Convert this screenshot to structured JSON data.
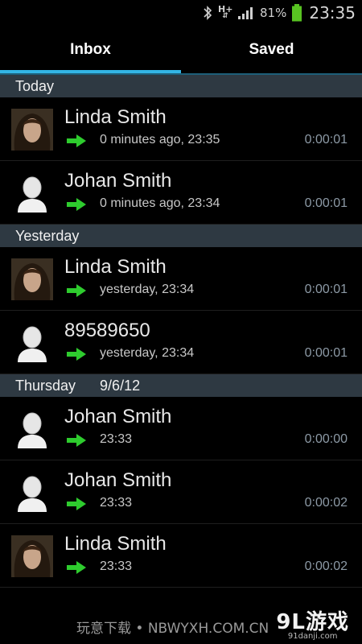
{
  "status_bar": {
    "network": "H+",
    "battery_percent": "81%",
    "time": "23:35",
    "icons": [
      "bluetooth-icon",
      "network-arrows-icon",
      "signal-icon",
      "battery-icon"
    ]
  },
  "tabs": [
    {
      "label": "Inbox",
      "active": true
    },
    {
      "label": "Saved",
      "active": false
    }
  ],
  "sections": [
    {
      "title": "Today",
      "date": "",
      "calls": [
        {
          "name": "Linda Smith",
          "when": "0 minutes ago, 23:35",
          "duration": "0:00:01",
          "avatar": "photo"
        },
        {
          "name": "Johan Smith",
          "when": "0 minutes ago, 23:34",
          "duration": "0:00:01",
          "avatar": "default"
        }
      ]
    },
    {
      "title": "Yesterday",
      "date": "",
      "calls": [
        {
          "name": "Linda Smith",
          "when": "yesterday, 23:34",
          "duration": "0:00:01",
          "avatar": "photo"
        },
        {
          "name": "89589650",
          "when": "yesterday, 23:34",
          "duration": "0:00:01",
          "avatar": "default"
        }
      ]
    },
    {
      "title": "Thursday",
      "date": "9/6/12",
      "calls": [
        {
          "name": "Johan Smith",
          "when": "23:33",
          "duration": "0:00:00",
          "avatar": "default"
        },
        {
          "name": "Johan Smith",
          "when": "23:33",
          "duration": "0:00:02",
          "avatar": "default"
        },
        {
          "name": "Linda Smith",
          "when": "23:33",
          "duration": "0:00:02",
          "avatar": "photo"
        }
      ]
    }
  ],
  "watermark": {
    "text": "玩意下载 • NBWYXH.COM.CN",
    "logo": "9L游戏",
    "logo_sub": "91danji.com"
  },
  "colors": {
    "accent": "#33b5e5",
    "section_bg": "#2e3942",
    "arrow": "#2ecc2e",
    "duration": "#8d9aa6"
  }
}
